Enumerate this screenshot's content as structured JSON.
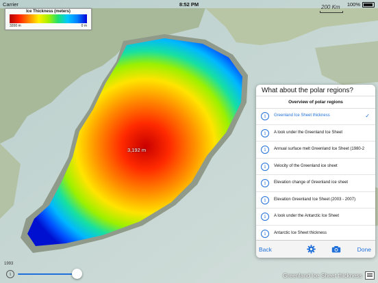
{
  "status_bar": {
    "carrier": "Carrier",
    "time": "8:52 PM",
    "battery": "100%"
  },
  "legend": {
    "title": "Ice Thickness (meters)",
    "min_label": "3200 m",
    "max_label": "0 m"
  },
  "scale": {
    "label": "200 Km"
  },
  "map": {
    "point_label": "3,192 m"
  },
  "panel": {
    "title": "What about the polar regions?",
    "header": "Overview of polar regions",
    "items": [
      {
        "label": "Greenland Ice Sheet thickness",
        "selected": true
      },
      {
        "label": "A look under the Greenland Ice Sheet",
        "selected": false
      },
      {
        "label": "Annual surface melt Greenland Ice Sheet (1980-2016)",
        "selected": false
      },
      {
        "label": "Velocity of the Greenland ice sheet",
        "selected": false
      },
      {
        "label": "Elevation change of Greenland ice sheet",
        "selected": false
      },
      {
        "label": "Elevation Greenland Ice Sheet (2003 - 2007)",
        "selected": false
      },
      {
        "label": "A look under the Antarctic Ice Sheet",
        "selected": false
      },
      {
        "label": "Antarctic Ice Sheet thickness",
        "selected": false
      }
    ],
    "toolbar": {
      "back": "Back",
      "done": "Done",
      "settings_icon": "gear-icon",
      "camera_icon": "camera-icon"
    }
  },
  "bottom": {
    "year": "1993",
    "layer_name": "Greenland Ice Sheet thickness",
    "slider_value": 1.0
  },
  "colors": {
    "accent": "#1e6fd9"
  }
}
